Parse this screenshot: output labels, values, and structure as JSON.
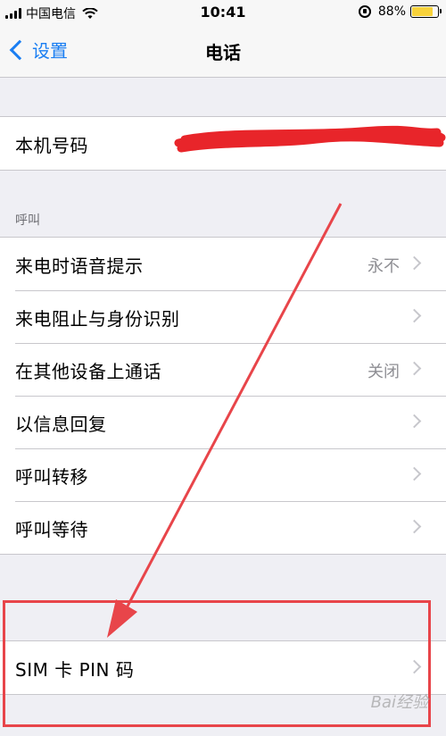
{
  "status_bar": {
    "carrier": "中国电信",
    "time": "10:41",
    "battery": "88%",
    "battery_level": 0.88
  },
  "nav": {
    "back_label": "设置",
    "title": "电话"
  },
  "phone_number": {
    "label": "本机号码"
  },
  "calls_section": {
    "header": "呼叫",
    "items": [
      {
        "label": "来电时语音提示",
        "value": "永不"
      },
      {
        "label": "来电阻止与身份识别",
        "value": ""
      },
      {
        "label": "在其他设备上通话",
        "value": "关闭"
      },
      {
        "label": "以信息回复",
        "value": ""
      },
      {
        "label": "呼叫转移",
        "value": ""
      },
      {
        "label": "呼叫等待",
        "value": ""
      }
    ]
  },
  "sim_pin": {
    "label": "SIM 卡 PIN 码"
  },
  "watermark": "Bai经验",
  "colors": {
    "accent": "#1a7ef2",
    "annotation": "#e8454a",
    "redaction": "#e8252a"
  }
}
